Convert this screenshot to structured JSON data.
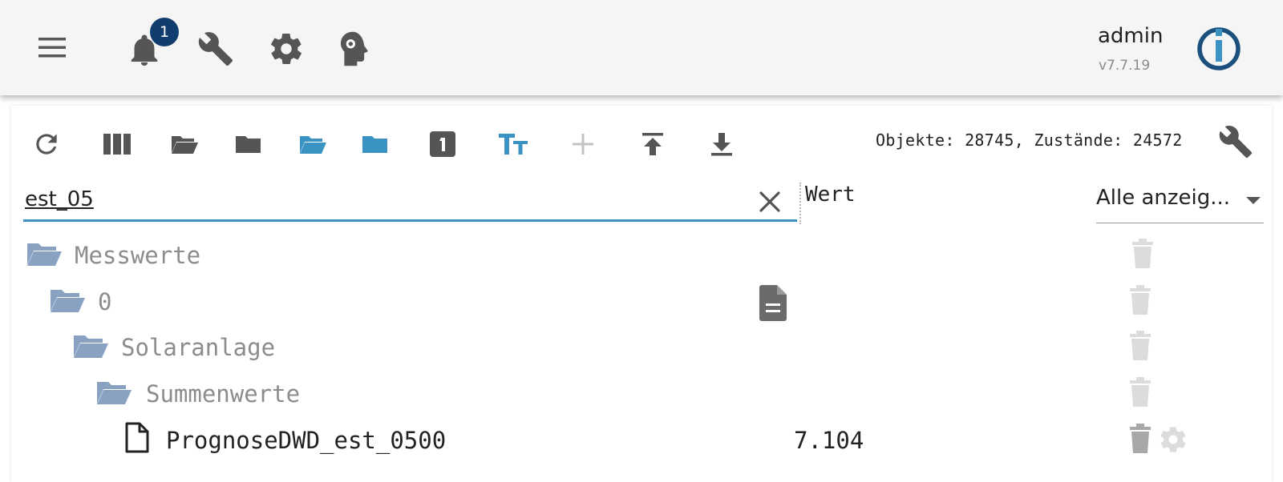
{
  "app": {
    "name": "ioBroker Admin"
  },
  "header": {
    "menu_icon": "menu-icon",
    "notification_count": "1",
    "user": {
      "name": "admin",
      "version": "v7.7.19"
    },
    "icons": [
      "bell-icon",
      "wrench-icon",
      "gear-icon",
      "expert-mode-icon",
      "iobroker-logo"
    ]
  },
  "toolbar": {
    "buttons": [
      "refresh",
      "columns",
      "expand-all",
      "collapse-all",
      "expand-one-level",
      "collapse-one-level",
      "state-count",
      "text-size",
      "add",
      "upload",
      "download"
    ],
    "stats": "Objekte: 28745, Zustände: 24572"
  },
  "filter": {
    "search_value": "est_05",
    "value_column": "Wert",
    "room_filter": "Alle anzeig..."
  },
  "tree": [
    {
      "name": "Messwerte",
      "type": "folder",
      "level": 0
    },
    {
      "name": "0",
      "type": "folder",
      "level": 1
    },
    {
      "name": "Solaranlage",
      "type": "folder",
      "level": 2
    },
    {
      "name": "Summenwerte",
      "type": "folder",
      "level": 3
    },
    {
      "name": "PrognoseDWD_est_0500",
      "type": "state",
      "level": 4,
      "value": "7.104"
    }
  ],
  "colors": {
    "accent": "#3a93c3",
    "badge": "#103d6e",
    "folder": "#8aa2c2",
    "icon_gray": "#555555"
  }
}
